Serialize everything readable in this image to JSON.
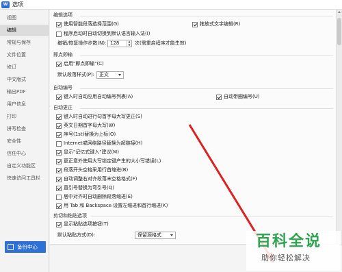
{
  "window": {
    "title": "选项",
    "icon_label": "W"
  },
  "sidebar": {
    "items": [
      {
        "label": "视图",
        "active": false
      },
      {
        "label": "编辑",
        "active": true
      },
      {
        "label": "常规与保存",
        "active": false
      },
      {
        "label": "文件位置",
        "active": false
      },
      {
        "label": "修订",
        "active": false
      },
      {
        "label": "中文版式",
        "active": false
      },
      {
        "label": "输出PDF",
        "active": false
      },
      {
        "label": "用户信息",
        "active": false
      },
      {
        "label": "打印",
        "active": false
      },
      {
        "label": "拼写检查",
        "active": false
      },
      {
        "label": "安全性",
        "active": false
      },
      {
        "label": "信任中心",
        "active": false
      },
      {
        "label": "自定义功能区",
        "active": false
      },
      {
        "label": "快速访问工具栏",
        "active": false
      }
    ],
    "backup_label": "备份中心"
  },
  "edit_options": {
    "title": "编辑选项",
    "smart_select": "使用智能段落选择范围(G)",
    "drag_edit": "拖放式文字编辑(R)",
    "auto_switch_ime": "程序启动时自动切换到默认语言输入法(I)",
    "undo_label": "撤销/恢复操作步数(N):",
    "undo_value": "128",
    "undo_hint": "次(需重启程序才能生效)"
  },
  "click_and_type": {
    "title": "即点即输",
    "enable": "启用\"即点即输\"(C)",
    "default_style_label": "默认段落样式(P):",
    "default_style_value": "正文"
  },
  "auto_number": {
    "title": "自动编号",
    "auto_list": "键入时自动应用自动编号列表(A)",
    "auto_bullet": "自动带圈编号(U)"
  },
  "auto_correct": {
    "title": "自动更正",
    "items": [
      "键入时自动进行句首字母大写更正(S)",
      "英文日期首字母大写(W)",
      "序号(1st)替换为上标(O)",
      "Internet或网络路径替换为超链接(H)",
      "显示\"记忆式键入\"建议(M)",
      "更正意外使用大写锁定键产生的大小写错误(L)",
      "段落开头空格采用行首缩进(B)",
      "自动调整右对齐段落末空格格式(F)",
      "直引号替换为弯引号(Q)",
      "居中对齐时自动删除段落缩进(E)",
      "用 Tab 和 Backspace 设置左缩进和首行缩进(K)"
    ],
    "checked": [
      true,
      true,
      true,
      false,
      true,
      true,
      true,
      true,
      true,
      false,
      true
    ]
  },
  "cut_paste": {
    "title": "剪切和粘贴选项",
    "show_paste_button": "显示粘贴选项按钮(T)",
    "default_paste_label": "默认粘贴方式(D):",
    "default_paste_value": "保留源格式"
  },
  "watermark": {
    "main": "百科全说",
    "sub": "助你轻松解决"
  },
  "colors": {
    "accent": "#2f6fd8",
    "arrow": "#e02020",
    "watermark_green": "#2ea44f"
  }
}
